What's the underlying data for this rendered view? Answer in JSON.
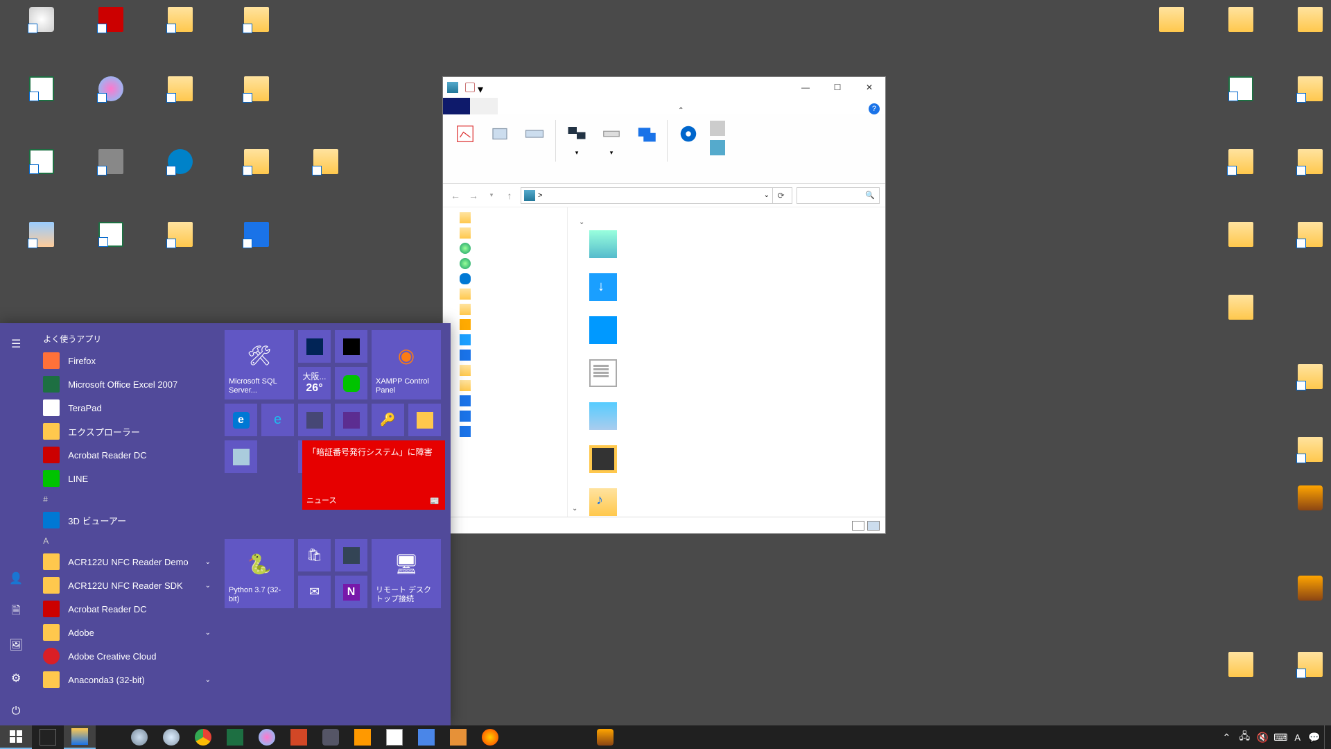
{
  "start_menu": {
    "frequent_header": "よく使うアプリ",
    "frequent": [
      {
        "label": "Firefox",
        "icon": "ai-ff"
      },
      {
        "label": "Microsoft Office Excel 2007",
        "icon": "ai-xl"
      },
      {
        "label": "TeraPad",
        "icon": "ai-tp"
      },
      {
        "label": "エクスプローラー",
        "icon": "ai-ex"
      },
      {
        "label": "Acrobat Reader DC",
        "icon": "ai-ar"
      },
      {
        "label": "LINE",
        "icon": "ai-line"
      }
    ],
    "section_hash": "#",
    "section_a": "A",
    "apps_hash": [
      {
        "label": "3D ビューアー",
        "icon": "ai-3d"
      }
    ],
    "apps_a": [
      {
        "label": "ACR122U NFC Reader Demo",
        "icon": "ai-fold",
        "chevron": true
      },
      {
        "label": "ACR122U NFC Reader SDK",
        "icon": "ai-fold",
        "chevron": true
      },
      {
        "label": "Acrobat Reader DC",
        "icon": "ai-ar"
      },
      {
        "label": "Adobe",
        "icon": "ai-fold",
        "chevron": true
      },
      {
        "label": "Adobe Creative Cloud",
        "icon": "ai-cc"
      },
      {
        "label": "Anaconda3 (32-bit)",
        "icon": "ai-fold",
        "chevron": true
      }
    ],
    "tiles": {
      "sql": "Microsoft SQL Server...",
      "weather_loc": "大阪...",
      "weather_temp": "26°",
      "xampp": "XAMPP Control Panel",
      "python": "Python 3.7 (32-bit)",
      "rdp": "リモート デスクトップ接続",
      "news_headline": "「暗証番号発行システム」に障害",
      "news_label": "ニュース"
    }
  },
  "explorer": {
    "breadcrumb": ">",
    "nav_items": [
      {
        "cls": "folder"
      },
      {
        "cls": "folder"
      },
      {
        "cls": "globe"
      },
      {
        "cls": "globe"
      },
      {
        "cls": "cloud"
      },
      {
        "cls": "folder"
      },
      {
        "cls": "folder"
      },
      {
        "cls": "star"
      },
      {
        "cls": "dl"
      },
      {
        "cls": "desk"
      },
      {
        "cls": "folder"
      },
      {
        "cls": "folder"
      },
      {
        "cls": "music"
      },
      {
        "cls": "recent"
      },
      {
        "cls": "recent"
      }
    ],
    "content": [
      {
        "cls": "f3d"
      },
      {
        "cls": "dl"
      },
      {
        "cls": "desk"
      },
      {
        "cls": "doc"
      },
      {
        "cls": "pic"
      },
      {
        "cls": "video"
      },
      {
        "cls": "music"
      }
    ]
  },
  "taskbar": {
    "ime": "A"
  }
}
